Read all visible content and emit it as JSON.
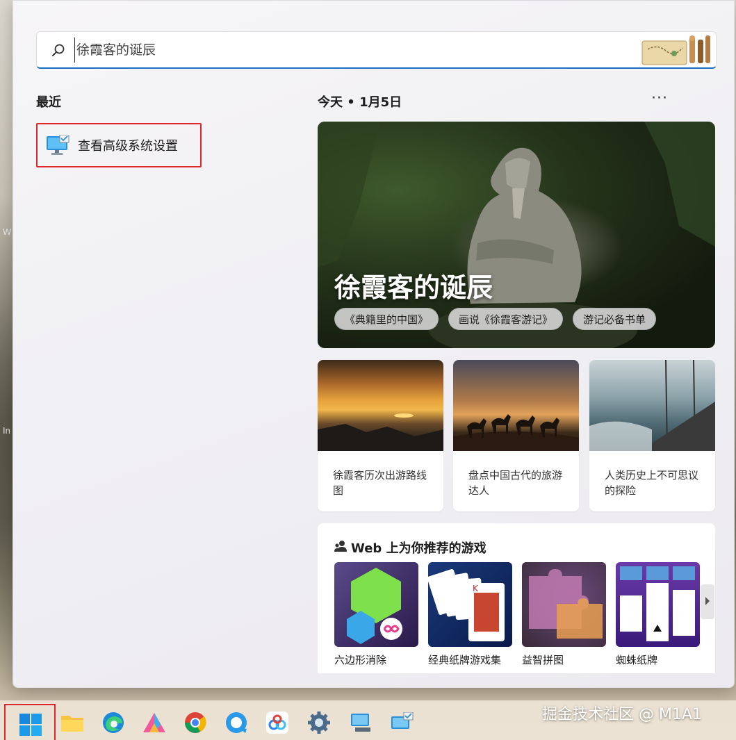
{
  "search": {
    "placeholder": "徐霞客的诞辰"
  },
  "recent": {
    "title": "最近",
    "items": [
      {
        "label": "查看高级系统设置"
      }
    ]
  },
  "today": {
    "label": "今天",
    "date": "1月5日",
    "more": "···"
  },
  "hero": {
    "title": "徐霞客的诞辰",
    "chips": [
      "《典籍里的中国》",
      "画说《徐霞客游记》",
      "游记必备书单"
    ]
  },
  "cards": [
    {
      "caption": "徐霞客历次出游路线图"
    },
    {
      "caption": "盘点中国古代的旅游达人"
    },
    {
      "caption": "人类历史上不可思议的探险"
    }
  ],
  "games": {
    "title": "Web 上为你推荐的游戏",
    "items": [
      {
        "name": "六边形消除"
      },
      {
        "name": "经典纸牌游戏集"
      },
      {
        "name": "益智拼图"
      },
      {
        "name": "蜘蛛纸牌"
      }
    ]
  },
  "desktop_edge_text": [
    "W",
    "In"
  ],
  "watermark": "掘金技术社区 @ M1A1",
  "taskbar": {
    "icons": [
      "windows-start-icon",
      "file-explorer-icon",
      "edge-icon",
      "azure-data-studio-icon",
      "chrome-icon",
      "edge-beta-icon",
      "baidu-netdisk-icon",
      "settings-icon",
      "computer-icon",
      "system-properties-icon"
    ]
  }
}
